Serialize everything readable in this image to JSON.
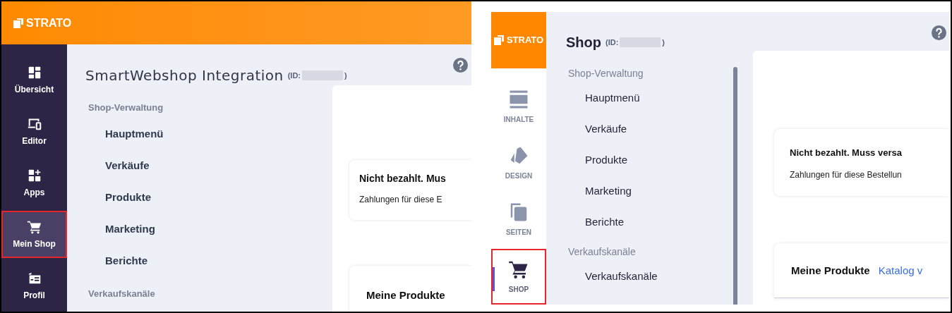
{
  "left_view": {
    "logo": "STRATO",
    "nav": [
      {
        "label": "Übersicht",
        "kind": "dashboard",
        "selected": false
      },
      {
        "label": "Editor",
        "kind": "devices",
        "selected": false
      },
      {
        "label": "Apps",
        "kind": "apps",
        "selected": false
      },
      {
        "label": "Mein Shop",
        "kind": "cart",
        "selected": true
      },
      {
        "label": "Profil",
        "kind": "profile",
        "selected": false
      }
    ],
    "title": "SmartWebshop Integration",
    "id_prefix": "(ID:",
    "id_suffix": ")",
    "sections": [
      {
        "heading": "Shop-Verwaltung",
        "items": [
          "Hauptmenü",
          "Verkäufe",
          "Produkte",
          "Marketing",
          "Berichte"
        ]
      },
      {
        "heading": "Verkaufskanäle"
      }
    ],
    "notice": {
      "title": "Nicht bezahlt. Mus",
      "text": "Zahlungen für diese E"
    },
    "products": {
      "title": "Meine Produkte"
    }
  },
  "right_view": {
    "logo": "STRATO",
    "nav": [
      {
        "label": "INHALTE",
        "kind": "rows",
        "selected": false
      },
      {
        "label": "DESIGN",
        "kind": "swatch",
        "selected": false
      },
      {
        "label": "SEITEN",
        "kind": "pages",
        "selected": false
      },
      {
        "label": "SHOP",
        "kind": "cart",
        "selected": true
      }
    ],
    "title": "Shop",
    "id_prefix": "(ID:",
    "id_suffix": ")",
    "sections": [
      {
        "heading": "Shop-Verwaltung",
        "items": [
          "Hauptmenü",
          "Verkäufe",
          "Produkte",
          "Marketing",
          "Berichte"
        ]
      },
      {
        "heading": "Verkaufskanäle",
        "items": [
          "Verkaufskanäle"
        ]
      }
    ],
    "notice": {
      "title": "Nicht bezahlt. Muss versa",
      "text": "Zahlungen für diese Bestellun"
    },
    "products": {
      "title": "Meine Produkte",
      "link": "Katalog v"
    }
  }
}
